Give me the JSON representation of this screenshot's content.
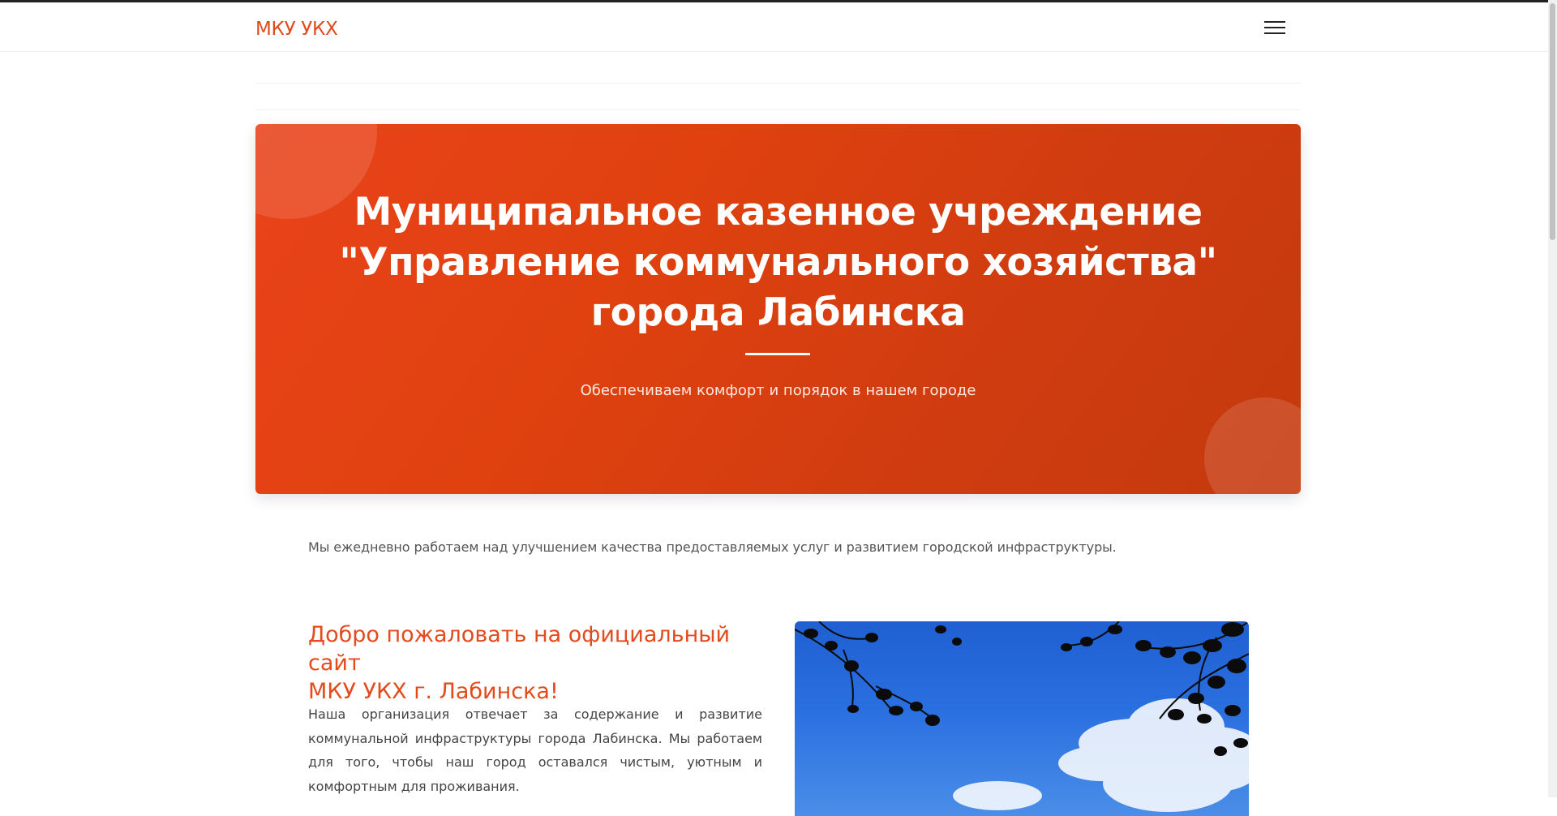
{
  "header": {
    "brand": "МКУ УКХ",
    "menu_icon": "hamburger-menu-icon"
  },
  "hero": {
    "title_lines": [
      "Муниципальное казенное учреждение",
      "\"Управление коммунального хозяйства\"",
      "города Лабинска"
    ],
    "subtitle": "Обеспечиваем комфорт и порядок в нашем городе"
  },
  "intro": "Мы ежедневно работаем над улучшением качества предоставляемых услуг и развитием городской инфраструктуры.",
  "welcome": {
    "title_lines": [
      "Добро пожаловать на официальный сайт",
      "МКУ УКХ г. Лабинска!"
    ],
    "body": "Наша организация отвечает за содержание и развитие коммунальной инфраструктуры города Лабинска. Мы работаем для того, чтобы наш город оставался чистым, уютным и комфортным для проживания."
  },
  "colors": {
    "accent": "#e34a1c",
    "hero_start": "#e9431b",
    "hero_end": "#c43a0e",
    "sky": "#2a6fe0"
  }
}
